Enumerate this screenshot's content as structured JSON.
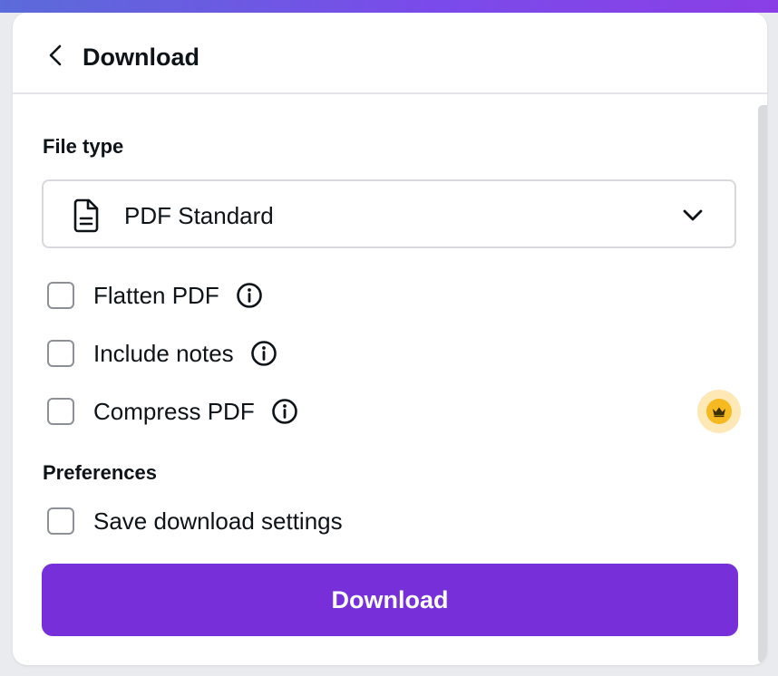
{
  "header": {
    "title": "Download"
  },
  "file_type": {
    "label": "File type",
    "selected": "PDF Standard",
    "icon": "document-icon"
  },
  "options": [
    {
      "label": "Flatten PDF",
      "checked": false,
      "has_info": true
    },
    {
      "label": "Include notes",
      "checked": false,
      "has_info": true
    },
    {
      "label": "Compress PDF",
      "checked": false,
      "has_info": true,
      "pro_badge": "crown-icon"
    }
  ],
  "preferences": {
    "label": "Preferences",
    "save_settings": {
      "label": "Save download settings",
      "checked": false
    }
  },
  "download_button": {
    "label": "Download"
  },
  "colors": {
    "primary": "#7730d9",
    "text": "#0e1318",
    "checkbox_border": "#8d9197",
    "pro_badge": "#f6b91f"
  }
}
